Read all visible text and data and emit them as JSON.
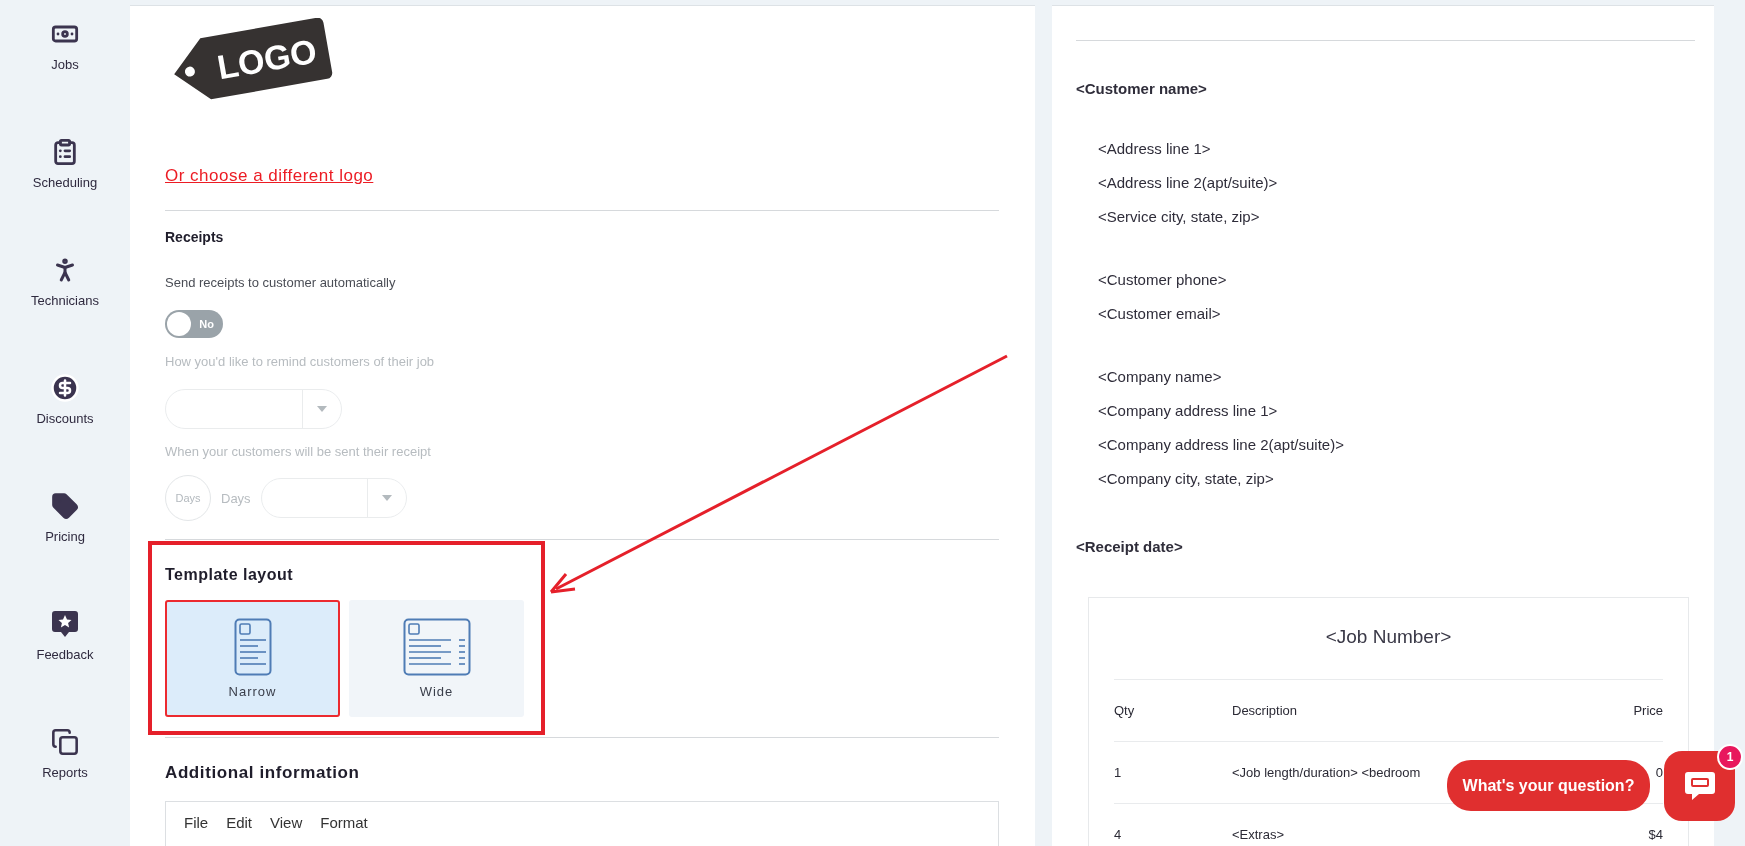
{
  "sidebar": {
    "items": [
      {
        "label": "Jobs"
      },
      {
        "label": "Scheduling"
      },
      {
        "label": "Technicians"
      },
      {
        "label": "Discounts"
      },
      {
        "label": "Pricing"
      },
      {
        "label": "Feedback"
      },
      {
        "label": "Reports"
      }
    ]
  },
  "settings": {
    "logo_text": "LOGO",
    "logo_link": "Or choose a different logo",
    "receipts": {
      "title": "Receipts",
      "auto_send": {
        "label": "Send receipts to customer automatically",
        "on": false,
        "toggle_text": "No"
      },
      "reminder": {
        "label": "How you'd like to remind customers of their job",
        "disabled": true
      },
      "send_time": {
        "label": "When your customers will be sent their receipt",
        "days_placeholder": "Days",
        "unit": "Days",
        "disabled": true
      }
    },
    "template_layout": {
      "title": "Template layout",
      "options": [
        {
          "label": "Narrow",
          "kind": "narrow",
          "selected": true
        },
        {
          "label": "Wide",
          "kind": "wide",
          "selected": false
        }
      ]
    },
    "additional_information": {
      "title": "Additional information",
      "menu": [
        "File",
        "Edit",
        "View",
        "Format"
      ]
    }
  },
  "preview": {
    "customer_name": "<Customer name>",
    "address_groups": [
      [
        "<Address line 1>",
        "<Address line 2(apt/suite)>",
        "<Service city, state, zip>"
      ],
      [
        "<Customer phone>",
        "<Customer email>"
      ],
      [
        "<Company name>",
        "<Company address line 1>",
        "<Company address line 2(apt/suite)>",
        "<Company city, state, zip>"
      ]
    ],
    "receipt_date": "<Receipt date>",
    "job": {
      "title": "<Job Number>",
      "columns": [
        "Qty",
        "Description",
        "Price"
      ],
      "rows": [
        [
          "1",
          "<Job length/duration> <bedroom",
          "0"
        ],
        [
          "4",
          "<Extras>",
          "$4"
        ]
      ]
    }
  },
  "chat": {
    "prompt": "What's your question?",
    "badge": "1"
  }
}
